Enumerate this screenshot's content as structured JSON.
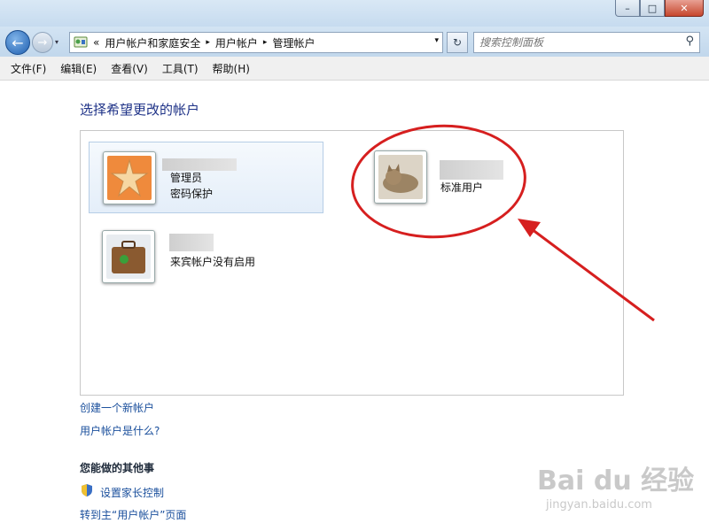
{
  "window": {
    "min_glyph": "–",
    "max_glyph": "□",
    "close_glyph": "✕"
  },
  "navigation": {
    "back_glyph": "←",
    "forward_glyph": "→",
    "history_glyph": "▾",
    "breadcrumb_prefix": "«",
    "breadcrumbs": [
      "用户帐户和家庭安全",
      "用户帐户",
      "管理帐户"
    ],
    "separator": "▸",
    "dropdown_glyph": "▾",
    "refresh_glyph": "↻",
    "search_placeholder": "搜索控制面板",
    "search_glyph": "⚲"
  },
  "menu": {
    "items": [
      "文件(F)",
      "编辑(E)",
      "查看(V)",
      "工具(T)",
      "帮助(H)"
    ]
  },
  "main": {
    "heading": "选择希望更改的帐户",
    "accounts": [
      {
        "type": "管理员",
        "status": "密码保护",
        "avatar": "starfish-avatar-icon"
      },
      {
        "type": "标准用户",
        "avatar": "cat-avatar-icon"
      },
      {
        "type": "来宾帐户没有启用",
        "avatar": "suitcase-avatar-icon"
      }
    ],
    "links": [
      "创建一个新帐户",
      "用户帐户是什么?"
    ]
  },
  "other_tasks": {
    "heading": "您能做的其他事",
    "items": [
      "设置家长控制",
      "转到主“用户帐户”页面"
    ]
  },
  "annotation": {
    "color": "#d61f1f"
  },
  "watermark": {
    "logo": "Bai du 经验",
    "url": "jingyan.baidu.com"
  },
  "colors": {
    "heading": "#1e3287",
    "link": "#1a4f9c",
    "selected_bg": "#e4eef9"
  }
}
